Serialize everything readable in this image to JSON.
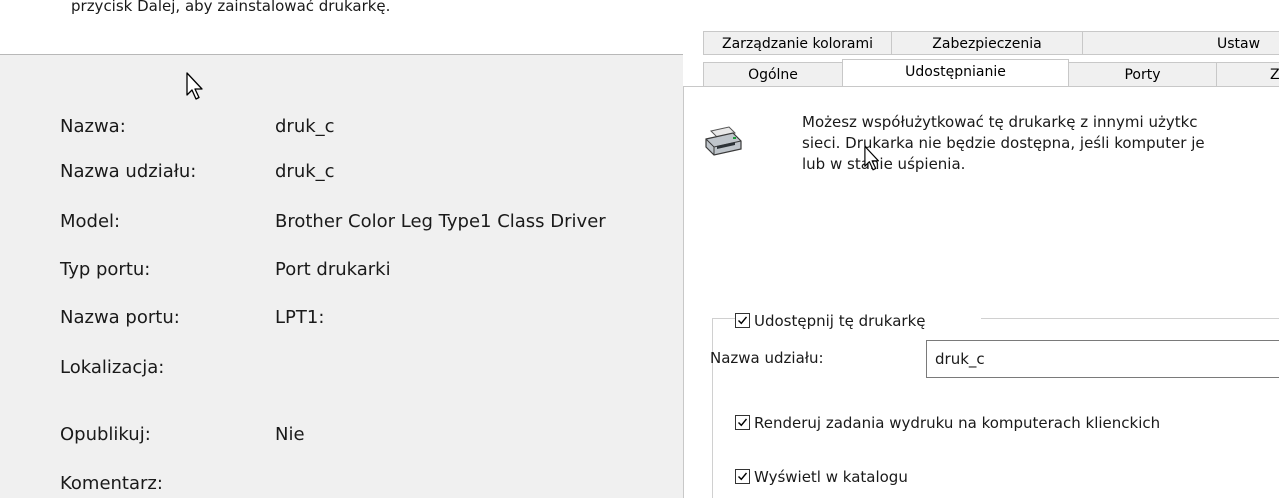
{
  "wizard": {
    "intro_text": "przycisk Dalej, aby zainstalować drukarkę.",
    "fields": [
      {
        "label": "Nazwa:",
        "value": "druk_c"
      },
      {
        "label": "Nazwa udziału:",
        "value": "druk_c"
      },
      {
        "label": "Model:",
        "value": "Brother Color Leg Type1 Class Driver"
      },
      {
        "label": "Typ portu:",
        "value": "Port drukarki"
      },
      {
        "label": "Nazwa portu:",
        "value": "LPT1:"
      },
      {
        "label": "Lokalizacja:",
        "value": ""
      },
      {
        "label": "Opublikuj:",
        "value": "Nie"
      },
      {
        "label": "Komentarz:",
        "value": ""
      }
    ]
  },
  "dialog": {
    "tabs_row1": [
      "Zarządzanie kolorami",
      "Zabezpieczenia",
      "Ustaw"
    ],
    "tabs_row2": [
      "Ogólne",
      "Udostępnianie",
      "Porty",
      "Z"
    ],
    "active_tab": "Udostępnianie",
    "info_lines": [
      "Możesz współużytkować tę drukarkę z innymi użytkc",
      "sieci. Drukarka nie będzie dostępna, jeśli komputer je",
      "lub w stanie uśpienia."
    ],
    "share_checkbox": {
      "label": "Udostępnij tę drukarkę",
      "checked": true
    },
    "share_name_label": "Nazwa udziału:",
    "share_name_value": "druk_c",
    "render_checkbox": {
      "label": "Renderuj zadania wydruku na komputerach klienckich",
      "checked": true
    },
    "catalog_checkbox": {
      "label": "Wyświetl w katalogu",
      "checked": true
    },
    "icons": {
      "printer": "printer-icon",
      "cursor": "mouse-pointer-icon"
    }
  }
}
